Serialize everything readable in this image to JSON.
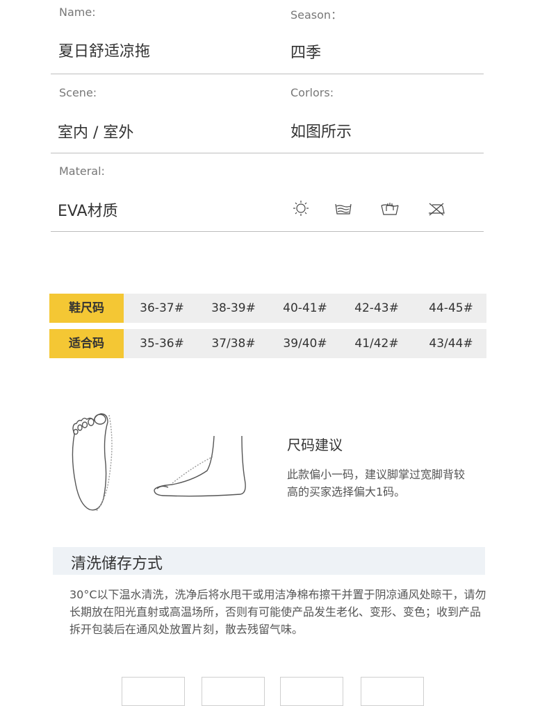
{
  "specs": {
    "name_label": "Name:",
    "name_value": "夏日舒适凉拖",
    "season_label": "Season：",
    "season_value": "四季",
    "scene_label": "Scene:",
    "scene_value": "室内 / 室外",
    "colors_label": "Corlors:",
    "colors_value": "如图所示",
    "material_label": "Materal:",
    "material_value": "EVA材质"
  },
  "care_icons": [
    "sun-dry-icon",
    "hand-wash-icon",
    "hand-wash-tub-icon",
    "do-not-iron-icon"
  ],
  "size_table": {
    "row1_header": "鞋尺码",
    "row1": [
      "36-37#",
      "38-39#",
      "40-41#",
      "42-43#",
      "44-45#"
    ],
    "row2_header": "适合码",
    "row2": [
      "35-36#",
      "37/38#",
      "39/40#",
      "41/42#",
      "43/44#"
    ],
    "accent_color": "#f4c734",
    "row_color": "#eeeeee"
  },
  "advice": {
    "title": "尺码建议",
    "text": "此款偏小一码，建议脚掌过宽脚背较高的买家选择偏大1码。"
  },
  "care": {
    "title": "清洗储存方式",
    "text": "30°C以下温水清洗，洗净后将水甩干或用洁净棉布擦干并置于阴凉通风处晾干，请勿长期放在阳光直射或高温场所，否则有可能使产品发生老化、变形、变色；收到产品拆开包装后在通风处放置片刻，散去残留气味。"
  }
}
